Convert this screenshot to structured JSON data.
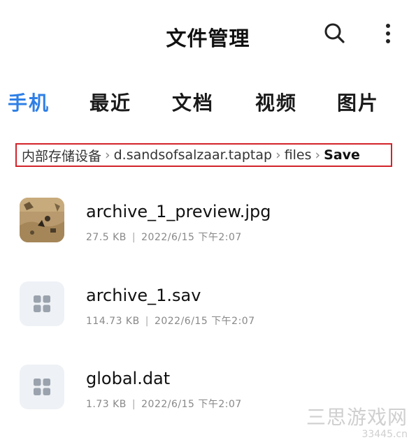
{
  "header": {
    "title": "文件管理",
    "search_icon": "search-icon",
    "more_icon": "more-vertical-icon"
  },
  "tabs": [
    {
      "label": "手机",
      "active": true
    },
    {
      "label": "最近",
      "active": false
    },
    {
      "label": "文档",
      "active": false
    },
    {
      "label": "视频",
      "active": false
    },
    {
      "label": "图片",
      "active": false
    }
  ],
  "breadcrumb": {
    "items": [
      "内部存储设备",
      "d.sandsofsalzaar.taptap",
      "files",
      "Save"
    ],
    "separator": "›",
    "highlight_color": "#d2232a"
  },
  "files": [
    {
      "name": "archive_1_preview.jpg",
      "size": "27.5 KB",
      "separator": "|",
      "date": "2022/6/15 下午2:07",
      "icon": "image-thumbnail"
    },
    {
      "name": "archive_1.sav",
      "size": "114.73 KB",
      "separator": "|",
      "date": "2022/6/15 下午2:07",
      "icon": "grid-file-icon"
    },
    {
      "name": "global.dat",
      "size": "1.73 KB",
      "separator": "|",
      "date": "2022/6/15 下午2:07",
      "icon": "grid-file-icon"
    }
  ],
  "watermark": {
    "line1": "三思游戏网",
    "line2": "33445.cn"
  },
  "colors": {
    "accent": "#2f7fe6",
    "text": "#111111",
    "meta": "#888888",
    "icon_bg": "#eef1f5",
    "icon_fg": "#9aa3ad"
  }
}
